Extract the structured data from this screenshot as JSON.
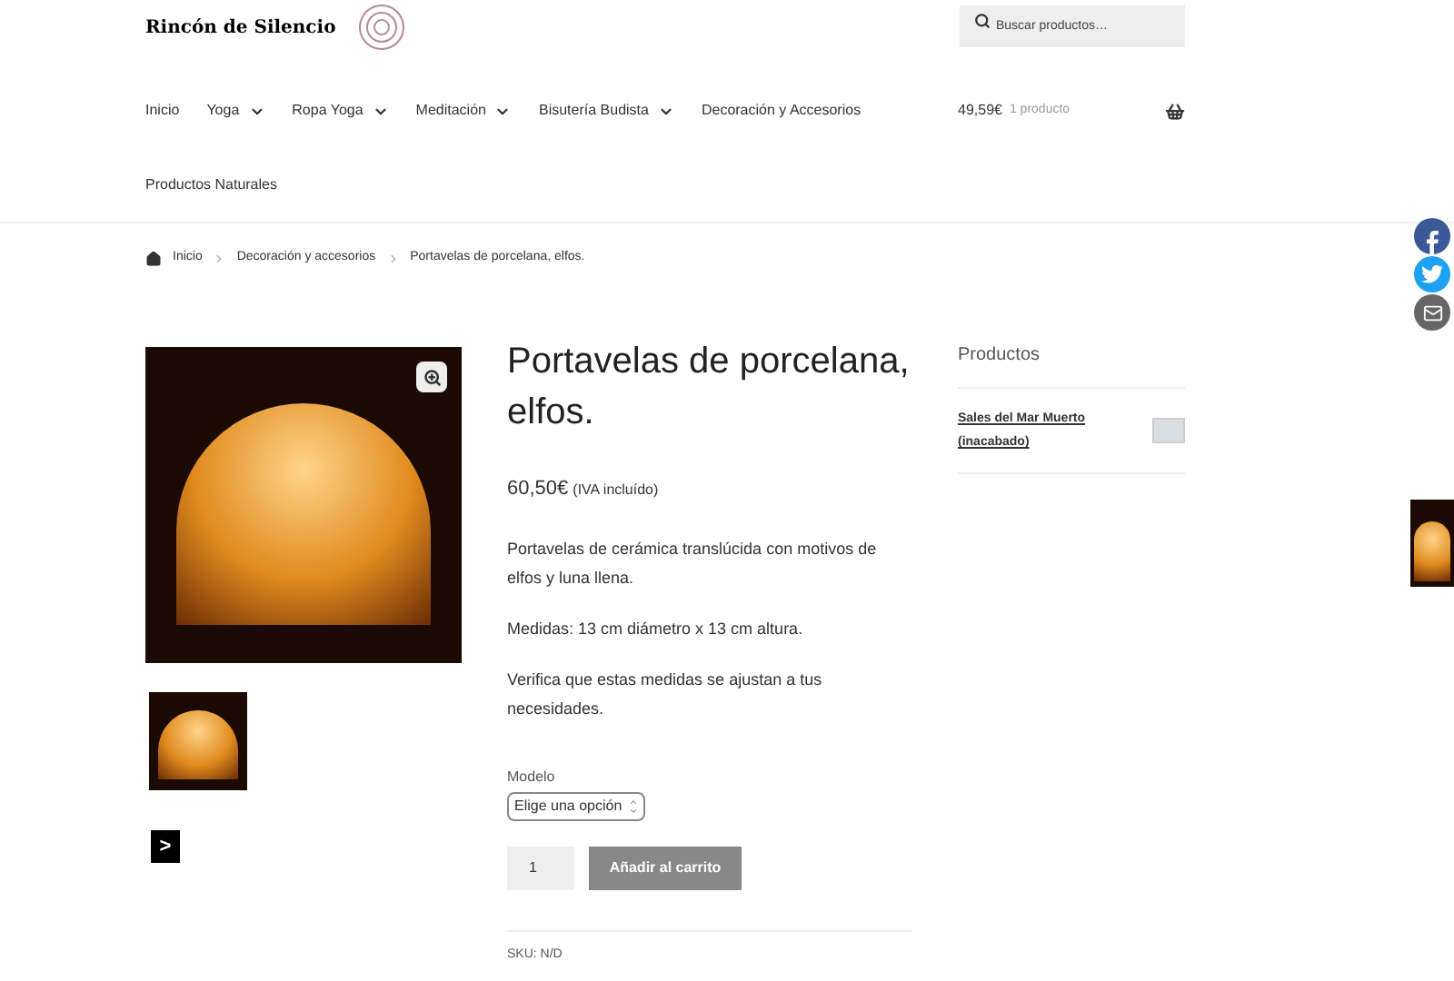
{
  "header": {
    "logo_text": "Rincón de Silencio",
    "search": {
      "placeholder": "Buscar productos…"
    }
  },
  "nav": {
    "items": [
      {
        "label": "Inicio",
        "has_submenu": false
      },
      {
        "label": "Yoga",
        "has_submenu": true
      },
      {
        "label": "Ropa Yoga",
        "has_submenu": true
      },
      {
        "label": "Meditación",
        "has_submenu": true
      },
      {
        "label": "Bisutería Budista",
        "has_submenu": true
      },
      {
        "label": "Decoración y Accesorios",
        "has_submenu": false
      },
      {
        "label": "Productos Naturales",
        "has_submenu": false
      }
    ],
    "cart": {
      "total": "49,59€",
      "count": "1 producto"
    }
  },
  "breadcrumb": [
    "Inicio",
    "Decoración y accesorios",
    "Portavelas de porcelana, elfos."
  ],
  "product": {
    "title": "Portavelas de porcelana, elfos.",
    "price": "60,50€",
    "tax_note": "(IVA incluído)",
    "description": [
      "Portavelas de cerámica translúcida con motivos de elfos y luna llena.",
      "Medidas: 13 cm diámetro x 13 cm altura.",
      "Verifica que estas medidas se ajustan a tus necesidades."
    ],
    "variation": {
      "label": "Modelo",
      "value": "Elige una opción"
    },
    "quantity": "1",
    "add_to_cart": "Añadir al carrito",
    "sku": "SKU: N/D",
    "gallery_next": ">"
  },
  "sidebar": {
    "title": "Productos",
    "items": [
      {
        "name": "Sales del Mar Muerto (inacabado)"
      }
    ]
  }
}
